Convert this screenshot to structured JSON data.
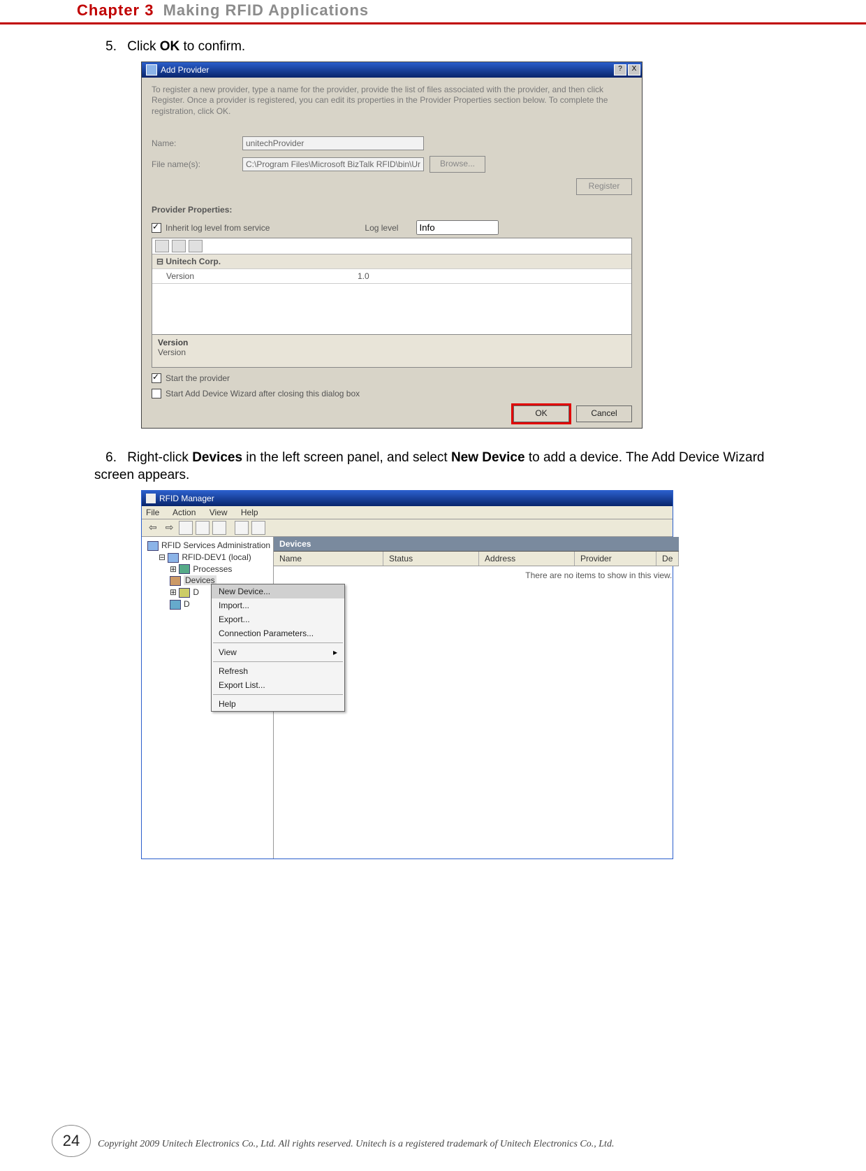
{
  "header": {
    "chapter": "Chapter 3",
    "title": "Making RFID Applications"
  },
  "step5": {
    "num": "5.",
    "prefix": "Click ",
    "bold": "OK",
    "suffix": " to confirm."
  },
  "dlg": {
    "title": "Add Provider",
    "help_btn": "?",
    "close_btn": "X",
    "desc": "To register a new provider, type a name for the provider, provide the list of files associated with the provider, and then click Register. Once a provider is registered, you can edit its properties in the Provider Properties section below. To complete the registration, click OK.",
    "name_label": "Name:",
    "name_value": "unitechProvider",
    "file_label": "File name(s):",
    "file_value": "C:\\Program Files\\Microsoft BizTalk RFID\\bin\\Ur",
    "browse": "Browse...",
    "register": "Register",
    "props_label": "Provider Properties:",
    "inherit_label": "Inherit log level from service",
    "loglevel_label": "Log level",
    "loglevel_value": "Info",
    "grid_header": "Unitech Corp.",
    "grid_row_label": "Version",
    "grid_row_value": "1.0",
    "desc_panel_h": "Version",
    "desc_panel_t": "Version",
    "chk1": "Start the provider",
    "chk2": "Start Add Device Wizard after closing this dialog box",
    "ok": "OK",
    "cancel": "Cancel"
  },
  "step6": {
    "num": "6.",
    "prefix": "Right-click ",
    "bold1": "Devices",
    "mid": " in the left screen panel, and select ",
    "bold2": "New Device",
    "suffix": " to add a device. The Add Device Wizard screen appears."
  },
  "win": {
    "title": "RFID Manager",
    "menu": {
      "file": "File",
      "action": "Action",
      "view": "View",
      "help": "Help"
    },
    "tree": {
      "root": "RFID Services Administration",
      "n1": "RFID-DEV1 (local)",
      "n2": "Processes",
      "n3": "Devices",
      "n4": "D",
      "n5": "D"
    },
    "panel_header": "Devices",
    "cols": {
      "name": "Name",
      "status": "Status",
      "address": "Address",
      "provider": "Provider",
      "d": "De"
    },
    "empty": "There are no items to show in this view.",
    "menu_items": {
      "new_device": "New Device...",
      "import": "Import...",
      "export": "Export...",
      "conn": "Connection Parameters...",
      "view": "View",
      "refresh": "Refresh",
      "export_list": "Export List...",
      "help": "Help"
    }
  },
  "footer": {
    "page": "24",
    "copyright": "Copyright 2009 Unitech Electronics Co., Ltd. All rights reserved. Unitech is a registered trademark of Unitech Electronics Co., Ltd."
  }
}
